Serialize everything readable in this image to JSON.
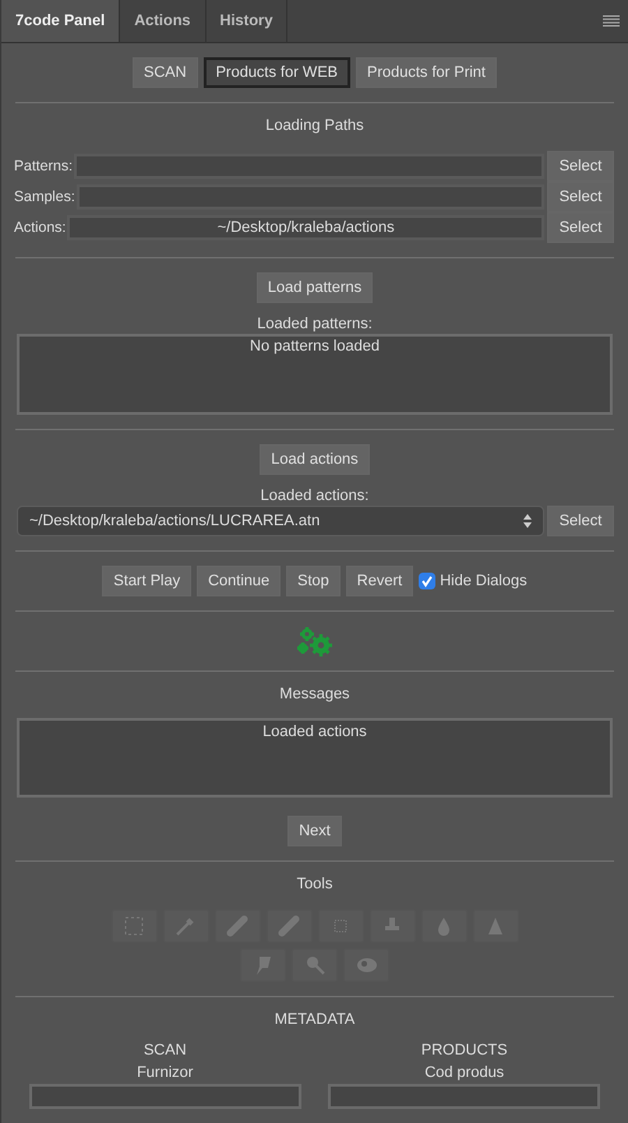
{
  "tabs": [
    {
      "label": "7code Panel",
      "selected": true
    },
    {
      "label": "Actions",
      "selected": false
    },
    {
      "label": "History",
      "selected": false
    }
  ],
  "modes": [
    {
      "label": "SCAN",
      "selected": false
    },
    {
      "label": "Products for WEB",
      "selected": true
    },
    {
      "label": "Products for Print",
      "selected": false
    }
  ],
  "loading_paths": {
    "title": "Loading Paths",
    "rows": [
      {
        "label": "Patterns:",
        "value": "",
        "button": "Select"
      },
      {
        "label": "Samples:",
        "value": "",
        "button": "Select"
      },
      {
        "label": "Actions:",
        "value": "~/Desktop/kraleba/actions",
        "button": "Select"
      }
    ]
  },
  "patterns": {
    "button": "Load patterns",
    "label": "Loaded patterns:",
    "list_text": "No patterns loaded"
  },
  "actions": {
    "button": "Load actions",
    "label": "Loaded actions:",
    "select_value": "~/Desktop/kraleba/actions/LUCRAREA.atn",
    "select_button": "Select"
  },
  "play_buttons": [
    "Start Play",
    "Continue",
    "Stop",
    "Revert"
  ],
  "hide_dialogs": {
    "label": "Hide Dialogs",
    "checked": true
  },
  "messages": {
    "title": "Messages",
    "text": "Loaded actions",
    "next_button": "Next"
  },
  "tools": {
    "title": "Tools",
    "rows": [
      [
        {
          "kind": "marquee"
        },
        {
          "kind": "eyedropper"
        },
        {
          "kind": "healing"
        },
        {
          "kind": "patch"
        },
        {
          "kind": "chip"
        },
        {
          "kind": "stamp"
        },
        {
          "kind": "drop"
        },
        {
          "kind": "cone"
        }
      ],
      [
        {
          "kind": "smudge"
        },
        {
          "kind": "zoom"
        },
        {
          "kind": "eye"
        }
      ]
    ]
  },
  "metadata": {
    "title": "METADATA",
    "columns": [
      {
        "heading": "SCAN",
        "field_label": "Furnizor"
      },
      {
        "heading": "PRODUCTS",
        "field_label": "Cod produs"
      }
    ]
  }
}
